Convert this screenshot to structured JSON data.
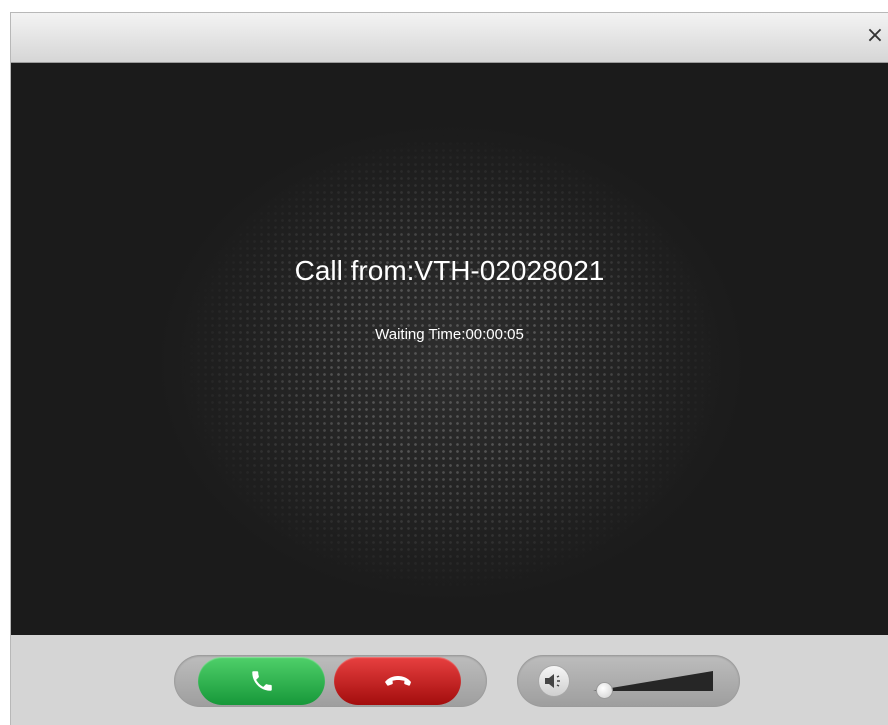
{
  "window": {
    "close_glyph": "×"
  },
  "call": {
    "caller_text": "Call from:VTH-02028021",
    "waiting_text": "Waiting Time:00:00:05"
  },
  "controls": {
    "answer_icon": "phone-answer-icon",
    "hangup_icon": "phone-hangup-icon",
    "speaker_icon": "speaker-icon",
    "volume_level": 0.0
  },
  "colors": {
    "answer": "#22aa44",
    "hangup": "#c81e1e",
    "video_bg": "#1b1b1b"
  }
}
